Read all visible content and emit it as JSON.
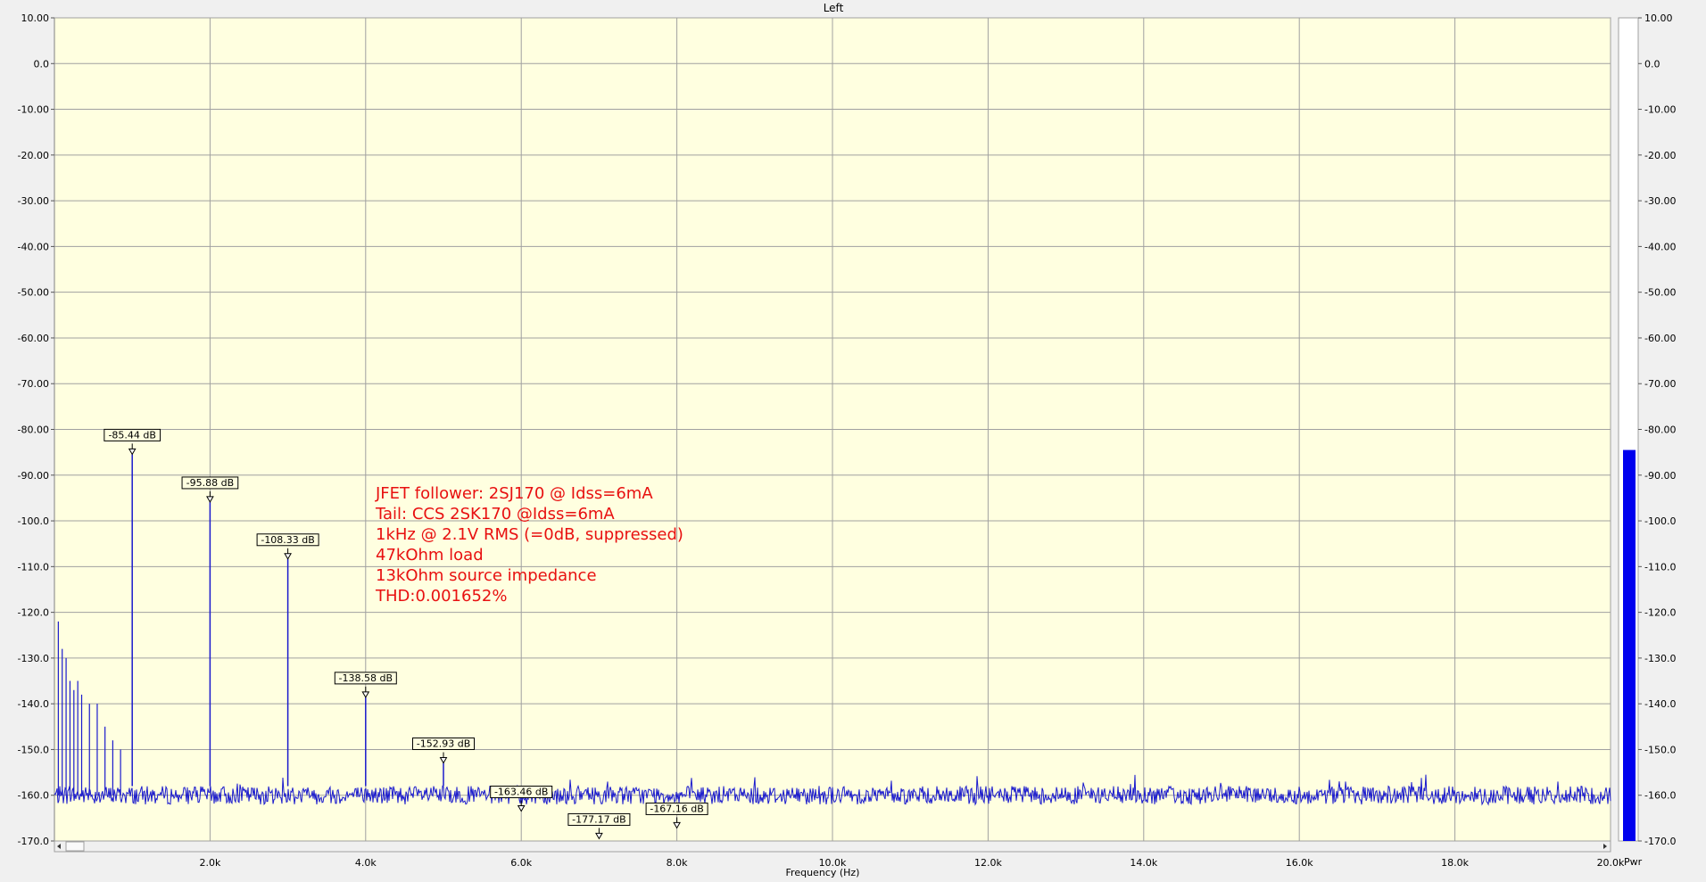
{
  "chart_data": {
    "type": "line",
    "title": "Left",
    "xlabel": "Frequency (Hz)",
    "ylabel": "",
    "xlim": [
      0,
      20000
    ],
    "ylim": [
      -170,
      10
    ],
    "x_ticks": [
      2000,
      4000,
      6000,
      8000,
      10000,
      12000,
      14000,
      16000,
      18000,
      20000
    ],
    "x_tick_labels": [
      "2.0k",
      "4.0k",
      "6.0k",
      "8.0k",
      "10.0k",
      "12.0k",
      "14.0k",
      "16.0k",
      "18.0k",
      "20.0k"
    ],
    "y_ticks": [
      10,
      0,
      -10,
      -20,
      -30,
      -40,
      -50,
      -60,
      -70,
      -80,
      -90,
      -100,
      -110,
      -120,
      -130,
      -140,
      -150,
      -160,
      -170
    ],
    "y_tick_labels": [
      "10.00",
      "0.0",
      "-10.00",
      "-20.00",
      "-30.00",
      "-40.00",
      "-50.00",
      "-60.00",
      "-70.00",
      "-80.00",
      "-90.00",
      "-100.0",
      "-110.0",
      "-120.0",
      "-130.0",
      "-140.0",
      "-150.0",
      "-160.0",
      "-170.0"
    ],
    "grid": true,
    "noise_floor_db": -160,
    "series": [
      {
        "color": "#1a1acd",
        "peaks": [
          {
            "x": 1000,
            "y": -85.44,
            "label": "-85.44 dB"
          },
          {
            "x": 2000,
            "y": -95.88,
            "label": "-95.88 dB"
          },
          {
            "x": 3000,
            "y": -108.33,
            "label": "-108.33 dB"
          },
          {
            "x": 4000,
            "y": -138.58,
            "label": "-138.58 dB"
          },
          {
            "x": 5000,
            "y": -152.93,
            "label": "-152.93 dB"
          },
          {
            "x": 6000,
            "y": -163.46,
            "label": "-163.46 dB"
          },
          {
            "x": 7000,
            "y": -177.17,
            "label": "-177.17 dB"
          },
          {
            "x": 8000,
            "y": -167.16,
            "label": "-167.16 dB"
          }
        ],
        "low_freq_spurs": [
          {
            "x": 50,
            "y": -122
          },
          {
            "x": 100,
            "y": -128
          },
          {
            "x": 150,
            "y": -130
          },
          {
            "x": 200,
            "y": -135
          },
          {
            "x": 250,
            "y": -137
          },
          {
            "x": 300,
            "y": -135
          },
          {
            "x": 350,
            "y": -138
          },
          {
            "x": 450,
            "y": -140
          },
          {
            "x": 550,
            "y": -140
          },
          {
            "x": 650,
            "y": -145
          },
          {
            "x": 750,
            "y": -148
          },
          {
            "x": 850,
            "y": -150
          }
        ]
      }
    ],
    "annotation": {
      "color": "#e81010",
      "lines": [
        "JFET follower: 2SJ170 @ Idss=6mA",
        "Tail: CCS 2SK170 @Idss=6mA",
        "1kHz @ 2.1V RMS (=0dB, suppressed)",
        "47kOhm load",
        "13kOhm source impedance",
        "THD:0.001652%"
      ]
    },
    "meter": {
      "label": "Pwr",
      "value_db": -84.5,
      "bar_color": "#0000ee",
      "ylim": [
        -170,
        10
      ],
      "tick_labels": [
        "10.00",
        "0.0",
        "-10.00",
        "-20.00",
        "-30.00",
        "-40.00",
        "-50.00",
        "-60.00",
        "-70.00",
        "-80.00",
        "-90.00",
        "-100.0",
        "-110.0",
        "-120.0",
        "-130.0",
        "-140.0",
        "-150.0",
        "-160.0",
        "-170.0"
      ]
    },
    "plot_background": "#ffffe0"
  }
}
